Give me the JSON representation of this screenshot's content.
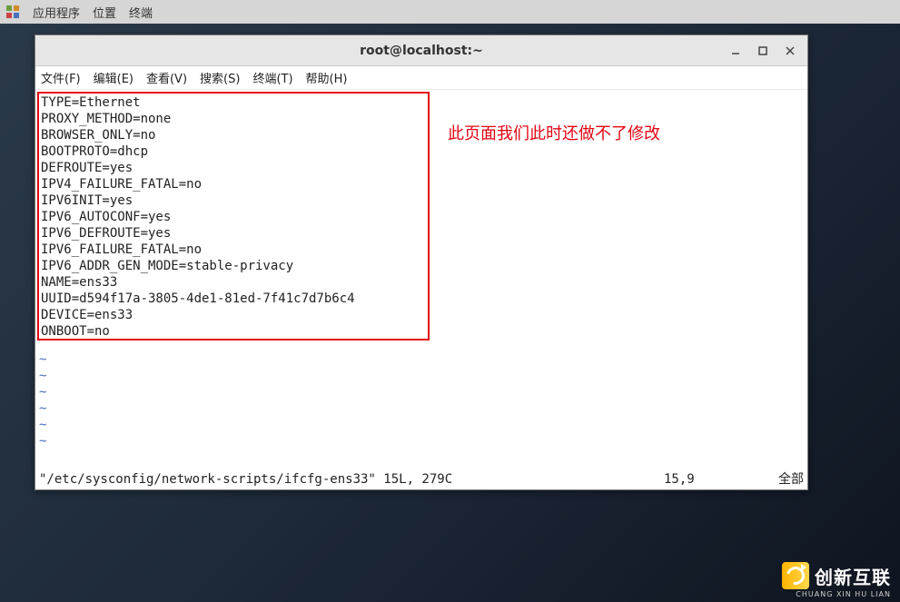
{
  "panel": {
    "items": [
      "应用程序",
      "位置",
      "终端"
    ]
  },
  "window": {
    "title": "root@localhost:~"
  },
  "menu": {
    "items": [
      "文件(F)",
      "编辑(E)",
      "查看(V)",
      "搜索(S)",
      "终端(T)",
      "帮助(H)"
    ]
  },
  "config": {
    "lines": [
      "TYPE=Ethernet",
      "PROXY_METHOD=none",
      "BROWSER_ONLY=no",
      "BOOTPROTO=dhcp",
      "DEFROUTE=yes",
      "IPV4_FAILURE_FATAL=no",
      "IPV6INIT=yes",
      "IPV6_AUTOCONF=yes",
      "IPV6_DEFROUTE=yes",
      "IPV6_FAILURE_FATAL=no",
      "IPV6_ADDR_GEN_MODE=stable-privacy",
      "NAME=ens33",
      "UUID=d594f17a-3805-4de1-81ed-7f41c7d7b6c4",
      "DEVICE=ens33",
      "ONBOOT=no"
    ]
  },
  "annotation": "此页面我们此时还做不了修改",
  "tildes": [
    "~",
    "~",
    "~",
    "~",
    "~",
    "~"
  ],
  "status": {
    "file": "\"/etc/sysconfig/network-scripts/ifcfg-ens33\" 15L, 279C",
    "position": "15,9",
    "scroll": "全部"
  },
  "watermark": {
    "main": "创新互联",
    "sub": "CHUANG XIN HU LIAN"
  }
}
